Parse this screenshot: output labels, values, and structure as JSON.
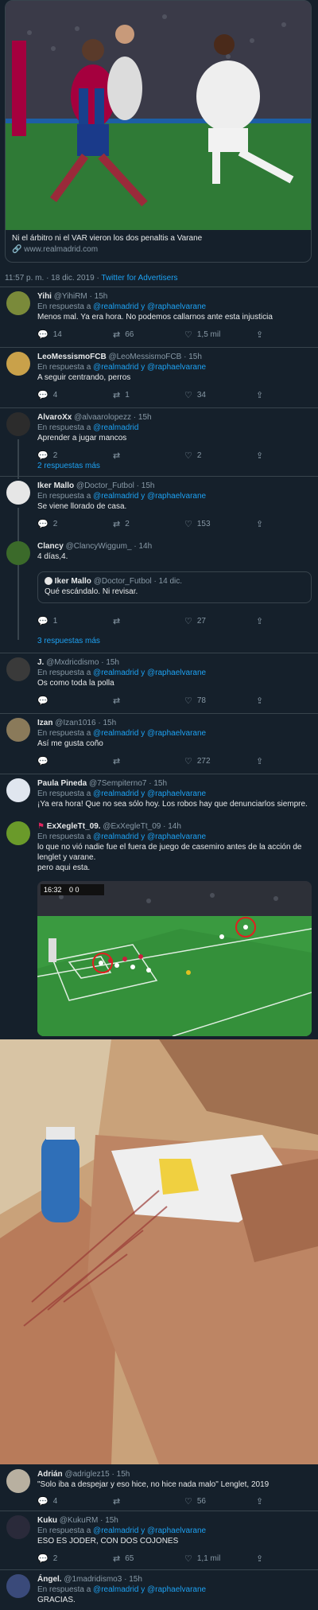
{
  "card": {
    "title": "Ni el árbitro ni el VAR vieron los dos penaltis a Varane",
    "url": "www.realmadrid.com"
  },
  "meta": {
    "time": "11:57 p. m. · 18 dic. 2019",
    "source": "Twitter for Advertisers"
  },
  "replies": [
    {
      "name": "Yihi",
      "handle": "@YihiRM",
      "time": "15h",
      "reply_to": "@realmadrid y @raphaelvarane",
      "text": "Menos mal. Ya era hora. No podemos callarnos ante esta injusticia",
      "replies": "14",
      "retweets": "66",
      "likes": "1,5 mil"
    },
    {
      "name": "LeoMessismoFCB",
      "handle": "@LeoMessismoFCB",
      "time": "15h",
      "reply_to": "@realmadrid y @raphaelvarane",
      "text": "A seguir centrando, perros",
      "replies": "4",
      "retweets": "1",
      "likes": "34"
    },
    {
      "name": "AlvaroXx",
      "handle": "@alvaarolopezz",
      "time": "15h",
      "reply_to": "@realmadrid",
      "text": "Aprender a jugar mancos",
      "replies": "2",
      "retweets": "",
      "likes": "2"
    },
    {
      "name": "Iker Mallo",
      "handle": "@Doctor_Futbol",
      "time": "15h",
      "reply_to": "@realmadrid y @raphaelvarane",
      "text": "Se viene llorado de casa.",
      "replies": "2",
      "retweets": "2",
      "likes": "153"
    },
    {
      "name": "Clancy",
      "handle": "@ClancyWiggum_",
      "time": "14h",
      "reply_to": "",
      "text": "4 días,4.",
      "replies": "1",
      "retweets": "",
      "likes": "27"
    },
    {
      "name": "J.",
      "handle": "@Mxdricdismo",
      "time": "15h",
      "reply_to": "@realmadrid y @raphaelvarane",
      "text": "Os como toda la polla",
      "replies": "",
      "retweets": "",
      "likes": "78"
    },
    {
      "name": "Izan",
      "handle": "@Izan1016",
      "time": "15h",
      "reply_to": "@realmadrid y @raphaelvarane",
      "text": "Así me gusta coño",
      "replies": "",
      "retweets": "",
      "likes": "272"
    },
    {
      "name": "Paula Pineda",
      "handle": "@7Sempiterno7",
      "time": "15h",
      "reply_to": "@realmadrid y @raphaelvarane",
      "text": "¡Ya era hora! Que no sea sólo hoy. Los robos hay que denunciarlos siempre.",
      "replies": "",
      "retweets": "",
      "likes": ""
    },
    {
      "name": "ExXegleTt_09.",
      "handle": "@ExXegleTt_09",
      "time": "14h",
      "reply_to": "@realmadrid y @raphaelvarane",
      "text": "lo que no vió nadie fue el fuera de juego de casemiro antes de la acción de lenglet y varane.",
      "text2": "pero aqui esta.",
      "replies": "",
      "retweets": "",
      "likes": ""
    },
    {
      "name": "Adrián",
      "handle": "@adriglez15",
      "time": "15h",
      "reply_to": "",
      "text": "\"Solo iba a despejar y eso hice, no hice nada malo\" Lenglet, 2019",
      "replies": "4",
      "retweets": "",
      "likes": "56"
    },
    {
      "name": "Kuku",
      "handle": "@KukuRM",
      "time": "15h",
      "reply_to": "@realmadrid y @raphaelvarane",
      "text": "ESO ES JODER, CON DOS COJONES",
      "replies": "2",
      "retweets": "65",
      "likes": "1,1 mil"
    },
    {
      "name": "Ángel.",
      "handle": "@1madridismo3",
      "time": "15h",
      "reply_to": "@realmadrid y @raphaelvarane",
      "text": "GRACIAS.",
      "replies": "",
      "retweets": "",
      "likes": ""
    }
  ],
  "quote": {
    "name": "Iker Mallo",
    "handle": "@Doctor_Futbol",
    "date": "14 dic.",
    "text": "Qué escándalo. Ni revisar."
  },
  "more_replies": [
    "2 respuestas más",
    "3 respuestas más"
  ],
  "labels": {
    "reply_prefix": "En respuesta a",
    "sep": "·"
  },
  "embed": {
    "clock": "16:32",
    "score": "0 0"
  }
}
